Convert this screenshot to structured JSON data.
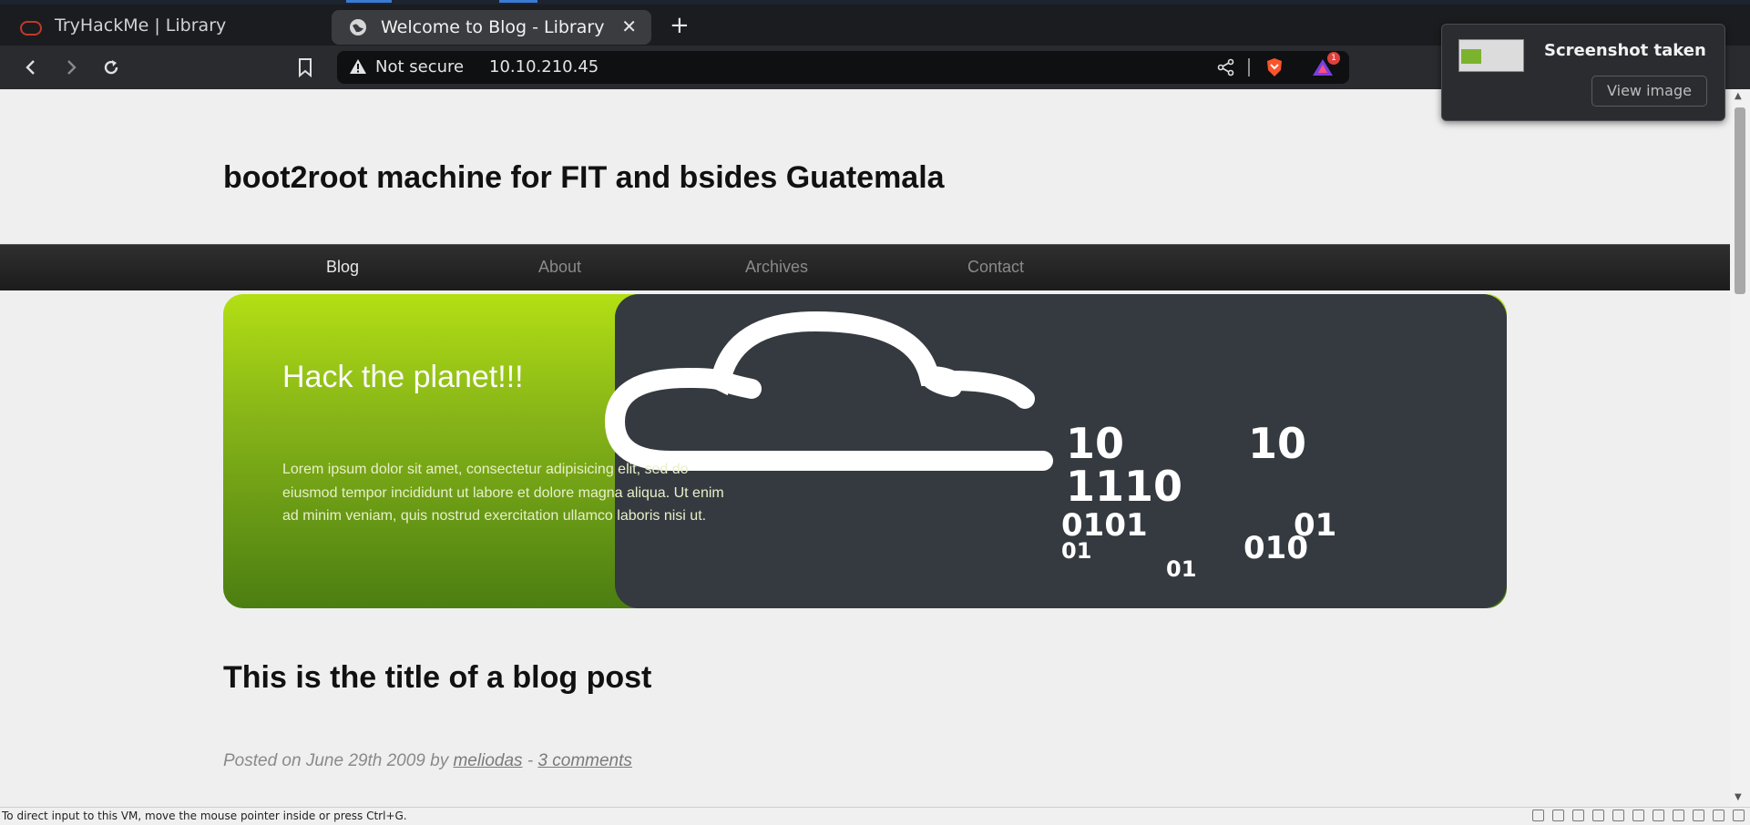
{
  "browser": {
    "vm_tab_title": "TryHackMe | Library",
    "active_tab_title": "Welcome to Blog - Library",
    "close_tab": "✕",
    "new_tab": "+",
    "security_label": "Not secure",
    "url": "10.10.210.45",
    "notification_count": "1"
  },
  "notification": {
    "title": "Screenshot taken",
    "button": "View image"
  },
  "site": {
    "title": "boot2root machine for FIT and bsides Guatemala",
    "nav": [
      {
        "label": "Blog",
        "active": true
      },
      {
        "label": "About",
        "active": false
      },
      {
        "label": "Archives",
        "active": false
      },
      {
        "label": "Contact",
        "active": false
      }
    ],
    "hero": {
      "heading": "Hack the planet!!!",
      "text": "Lorem ipsum dolor sit amet, consectetur adipisicing elit, sed do eiusmod tempor incididunt ut labore et dolore magna aliqua. Ut enim ad minim veniam, quis nostrud exercitation ullamco laboris nisi ut.",
      "binary": [
        "10",
        "10",
        "1110",
        "0101",
        "01",
        "01",
        "010",
        "01"
      ]
    },
    "post": {
      "title": "This is the title of a blog post",
      "posted_on": "Posted on June 29th 2009 by",
      "author": "meliodas",
      "separator": "-",
      "comments": "3 comments"
    }
  },
  "vm_status": {
    "message": "To direct input to this VM, move the mouse pointer inside or press Ctrl+G."
  },
  "colors": {
    "hero_green_top": "#b3df14",
    "hero_green_bottom": "#4b7e12",
    "hero_dark": "#353a40",
    "menu_bg": "#252525"
  },
  "icons": [
    "back-arrow-icon",
    "forward-arrow-icon",
    "reload-icon",
    "bookmark-icon",
    "warning-icon",
    "share-icon",
    "brave-shield-icon",
    "brave-rewards-icon",
    "globe-icon",
    "cloud-binary-icon"
  ]
}
